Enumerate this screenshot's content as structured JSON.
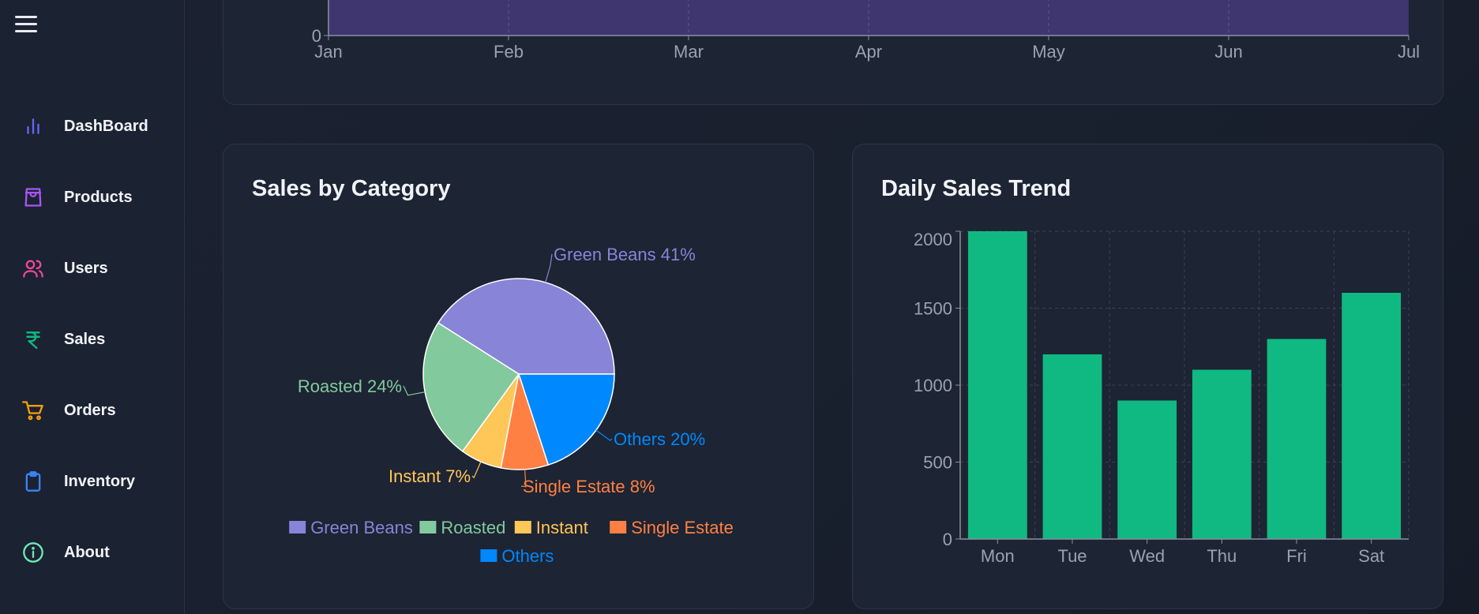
{
  "sidebar": {
    "items": [
      {
        "label": "DashBoard",
        "icon": "bar-chart-icon",
        "color": "#6366f1"
      },
      {
        "label": "Products",
        "icon": "shopping-bag-icon",
        "color": "#a855f7"
      },
      {
        "label": "Users",
        "icon": "users-icon",
        "color": "#ec4899"
      },
      {
        "label": "Sales",
        "icon": "rupee-icon",
        "color": "#10b981"
      },
      {
        "label": "Orders",
        "icon": "cart-icon",
        "color": "#f59e0b"
      },
      {
        "label": "Inventory",
        "icon": "clipboard-icon",
        "color": "#3b82f6"
      },
      {
        "label": "About",
        "icon": "info-icon",
        "color": "#6ee7b7"
      }
    ]
  },
  "chart_data": [
    {
      "type": "area",
      "categories": [
        "Jan",
        "Feb",
        "Mar",
        "Apr",
        "May",
        "Jun",
        "Jul"
      ],
      "y_tick_visible": "0",
      "ylim_min": 0,
      "fill_color": "#3f3670",
      "grid": true
    },
    {
      "type": "pie",
      "title": "Sales by Category",
      "slices": [
        {
          "name": "Green Beans",
          "value": 41,
          "label": "Green Beans 41%",
          "color": "#8884d8"
        },
        {
          "name": "Roasted",
          "value": 24,
          "label": "Roasted 24%",
          "color": "#82ca9d"
        },
        {
          "name": "Instant",
          "value": 7,
          "label": "Instant 7%",
          "color": "#ffc658"
        },
        {
          "name": "Single Estate",
          "value": 8,
          "label": "Single Estate 8%",
          "color": "#ff8042"
        },
        {
          "name": "Others",
          "value": 20,
          "label": "Others 20%",
          "color": "#0088fe"
        }
      ],
      "legend_placement": "bottom"
    },
    {
      "type": "bar",
      "title": "Daily Sales Trend",
      "categories": [
        "Mon",
        "Tue",
        "Wed",
        "Thu",
        "Fri",
        "Sat"
      ],
      "values": [
        2000,
        1200,
        900,
        1100,
        1300,
        1600
      ],
      "ylim": [
        0,
        2000
      ],
      "yticks": [
        "0",
        "500",
        "1000",
        "1500",
        "2000"
      ],
      "color": "#10b981",
      "grid": true
    }
  ]
}
